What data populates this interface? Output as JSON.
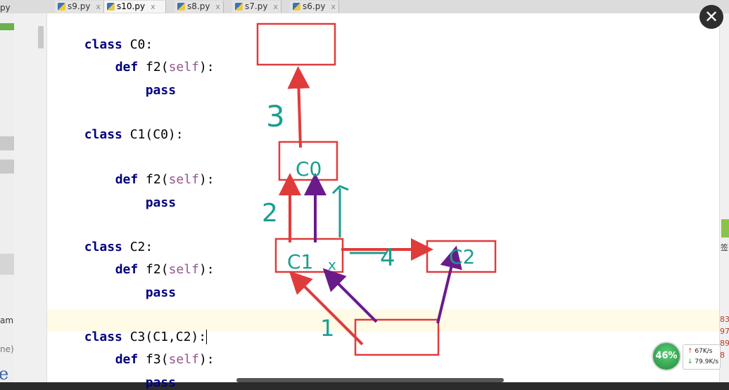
{
  "tabs": [
    {
      "label": "s9.py",
      "active": false
    },
    {
      "label": "s10.py",
      "active": true
    },
    {
      "label": "s8.py",
      "active": false
    },
    {
      "label": "s7.py",
      "active": false
    },
    {
      "label": "s6.py",
      "active": false
    }
  ],
  "tab_close_glyph": "x",
  "left_panel": {
    "top_text": "py",
    "file_label": "am File",
    "hint": "ne)",
    "glyph": "e"
  },
  "code": [
    {
      "kw": "class",
      "rest": "C0:"
    },
    {
      "kw": "def",
      "name": "f2",
      "param": "self"
    },
    {
      "kw": "pass"
    },
    {
      "kw": "class",
      "rest": "C1(C0):"
    },
    {
      "kw": "def",
      "name": "f2",
      "param": "self"
    },
    {
      "kw": "pass"
    },
    {
      "kw": "class",
      "rest": "C2:"
    },
    {
      "kw": "def",
      "name": "f2",
      "param": "self"
    },
    {
      "kw": "pass"
    },
    {
      "kw": "class",
      "rest": "C3(C1,C2):"
    },
    {
      "kw": "def",
      "name": "f3",
      "param": "self"
    },
    {
      "kw": "pass"
    }
  ],
  "annotations": {
    "box_c0": "C0",
    "box_c1": "C1",
    "box_c2": "C2",
    "num_1": "1",
    "num_2": "2",
    "num_3": "3",
    "num_4": "4",
    "x_mark": "x"
  },
  "close_button": "✕",
  "network_widget": {
    "cpu_percent": "46%",
    "upload": "67K/s",
    "download": "79.9K/s"
  },
  "right_edge": {
    "numbers": [
      "83",
      "97",
      "89",
      "8"
    ],
    "sign": "签"
  },
  "colors": {
    "red_box": "#e03b3b",
    "teal_ink": "#1a9e8f",
    "purple_arrow": "#6a1b8a",
    "keyword": "#000080",
    "param": "#94558d"
  }
}
